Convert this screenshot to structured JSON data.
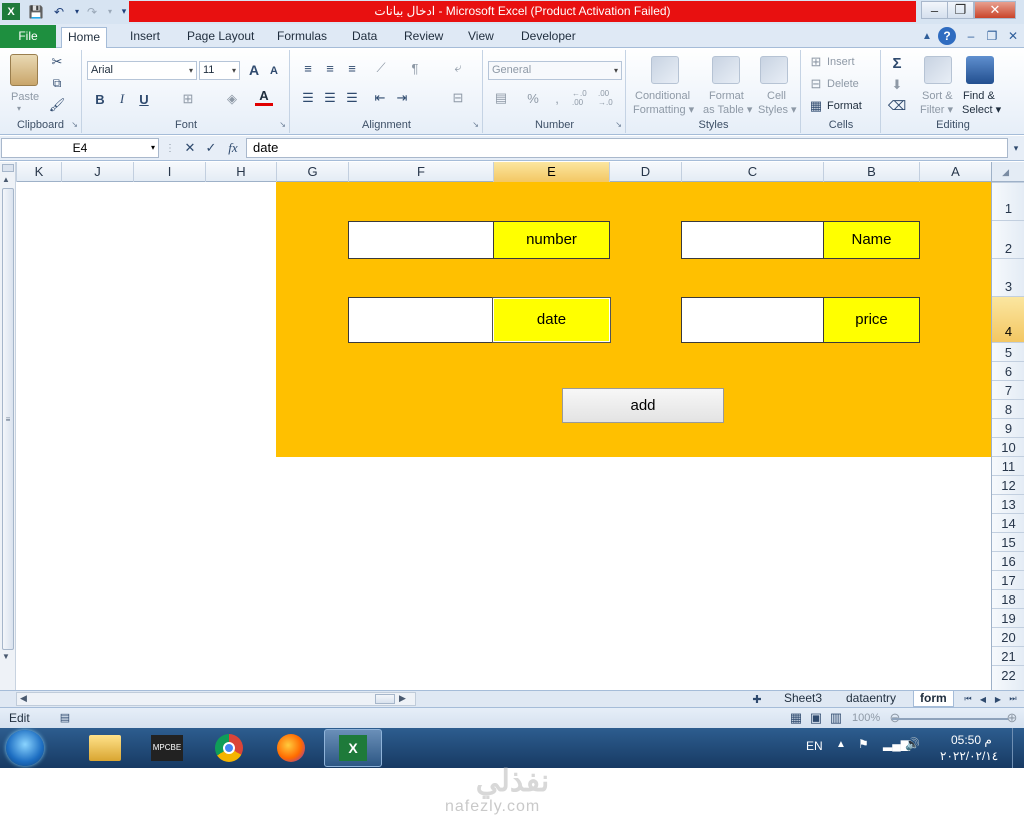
{
  "window": {
    "title": "ادخال بيانات  -  Microsoft Excel (Product Activation Failed)",
    "controls": {
      "minimize": "–",
      "restore": "❐",
      "close": "✕"
    }
  },
  "ribbon": {
    "tabs": [
      "File",
      "Home",
      "Insert",
      "Page Layout",
      "Formulas",
      "Data",
      "Review",
      "View",
      "Developer"
    ],
    "active_tab": "Home",
    "clipboard": {
      "paste": "Paste",
      "label": "Clipboard"
    },
    "font": {
      "name": "Arial",
      "size": "11",
      "bold": "B",
      "italic": "I",
      "underline": "U",
      "grow": "A",
      "shrink": "A",
      "color": "A",
      "label": "Font"
    },
    "alignment": {
      "label": "Alignment"
    },
    "number": {
      "format": "General",
      "percent": "%",
      "comma": ",",
      "inc_decimal": "←.0 .00",
      "dec_decimal": ".00 →.0",
      "label": "Number"
    },
    "styles": {
      "conditional": [
        "Conditional",
        "Formatting ▾"
      ],
      "format_table": [
        "Format",
        "as Table ▾"
      ],
      "cell_styles": [
        "Cell",
        "Styles ▾"
      ],
      "label": "Styles"
    },
    "cells": {
      "insert": "Insert",
      "delete": "Delete",
      "format": "Format",
      "label": "Cells"
    },
    "editing": {
      "sum": "Σ",
      "sort": [
        "Sort &",
        "Filter ▾"
      ],
      "find": [
        "Find &",
        "Select ▾"
      ],
      "label": "Editing"
    }
  },
  "formula_bar": {
    "name_box": "E4",
    "fx": "fx",
    "cancel": "✕",
    "enter": "✓",
    "value": "date"
  },
  "grid": {
    "columns": [
      "K",
      "J",
      "I",
      "H",
      "G",
      "F",
      "E",
      "D",
      "C",
      "B",
      "A"
    ],
    "selected_column": "E",
    "rows": [
      "1",
      "2",
      "3",
      "4",
      "5",
      "6",
      "7",
      "8",
      "9",
      "10",
      "11",
      "12",
      "13",
      "14",
      "15",
      "16",
      "17",
      "18",
      "19",
      "20",
      "21",
      "22"
    ],
    "selected_row": "4"
  },
  "form": {
    "number_label": "number",
    "date_label": "date",
    "name_label": "Name",
    "price_label": "price",
    "add_button": "add",
    "background": "#ffc000",
    "label_bg": "#ffff00"
  },
  "sheets": {
    "tabs": [
      "Sheet3",
      "dataentry",
      "form"
    ],
    "active": "form"
  },
  "status": {
    "mode": "Edit",
    "zoom": "100%"
  },
  "taskbar": {
    "apps": [
      "explorer",
      "mpc-be",
      "chrome",
      "firefox",
      "excel"
    ],
    "mpc_label": "MPCBE",
    "lang": "EN",
    "time": "05:50 م",
    "date": "٢٠٢٢/٠٢/١٤"
  },
  "watermark": {
    "logo": "نفذلي",
    "url": "nafezly.com"
  }
}
